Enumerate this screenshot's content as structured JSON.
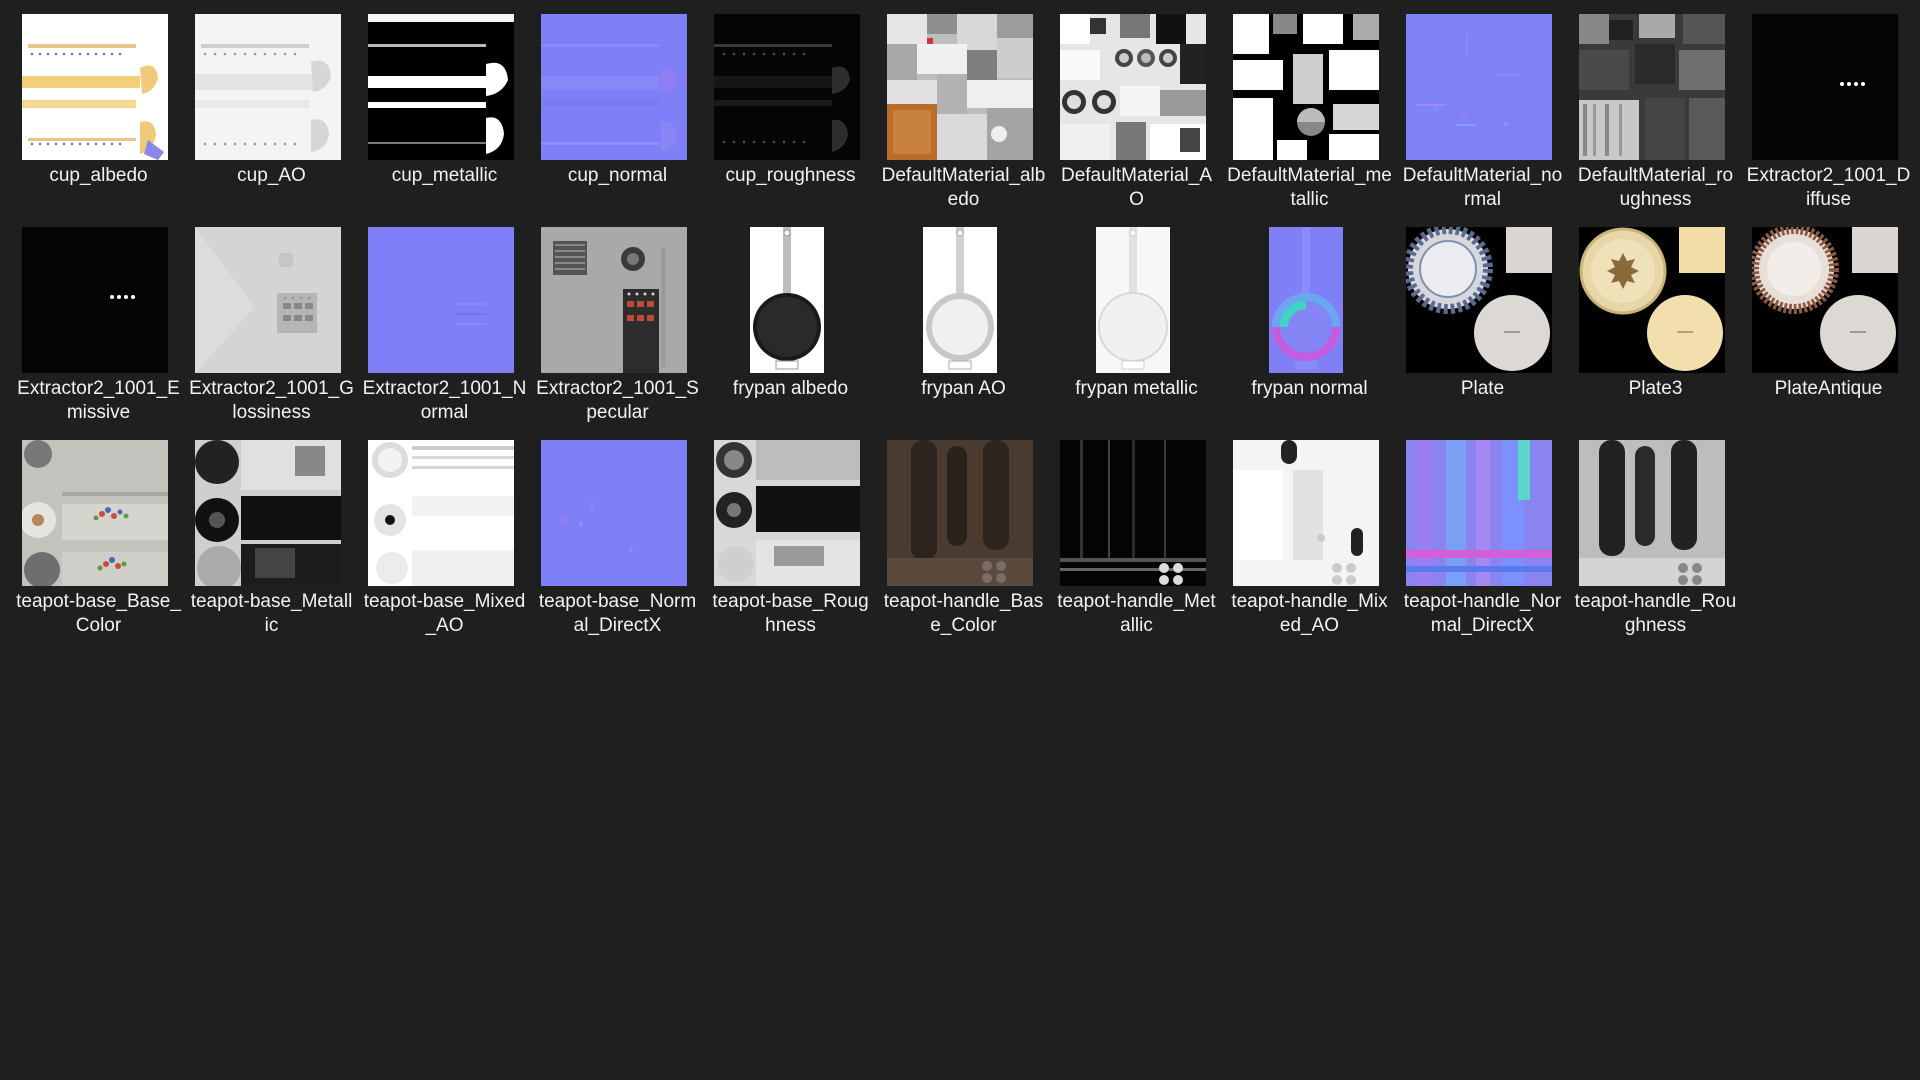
{
  "explorer": {
    "background": "#1f1f1f",
    "items": [
      {
        "name": "cup_albedo",
        "icon": "texture-cup-albedo-icon"
      },
      {
        "name": "cup_AO",
        "icon": "texture-cup-ao-icon"
      },
      {
        "name": "cup_metallic",
        "icon": "texture-cup-metallic-icon"
      },
      {
        "name": "cup_normal",
        "icon": "texture-cup-normal-icon"
      },
      {
        "name": "cup_roughness",
        "icon": "texture-cup-roughness-icon"
      },
      {
        "name": "DefaultMaterial_albedo",
        "icon": "texture-default-albedo-icon"
      },
      {
        "name": "DefaultMaterial_AO",
        "icon": "texture-default-ao-icon"
      },
      {
        "name": "DefaultMaterial_metallic",
        "icon": "texture-default-metallic-icon"
      },
      {
        "name": "DefaultMaterial_normal",
        "icon": "texture-default-normal-icon"
      },
      {
        "name": "DefaultMaterial_roughness",
        "icon": "texture-default-roughness-icon"
      },
      {
        "name": "Extractor2_1001_Diffuse",
        "icon": "texture-extractor-diffuse-icon"
      },
      {
        "name": "Extractor2_1001_Emissive",
        "icon": "texture-extractor-emissive-icon"
      },
      {
        "name": "Extractor2_1001_Glossiness",
        "icon": "texture-extractor-glossiness-icon"
      },
      {
        "name": "Extractor2_1001_Normal",
        "icon": "texture-extractor-normal-icon"
      },
      {
        "name": "Extractor2_1001_Specular",
        "icon": "texture-extractor-specular-icon"
      },
      {
        "name": "frypan albedo",
        "icon": "texture-frypan-albedo-icon"
      },
      {
        "name": "frypan AO",
        "icon": "texture-frypan-ao-icon"
      },
      {
        "name": "frypan metallic",
        "icon": "texture-frypan-metallic-icon"
      },
      {
        "name": "frypan normal",
        "icon": "texture-frypan-normal-icon"
      },
      {
        "name": "Plate",
        "icon": "texture-plate-icon"
      },
      {
        "name": "Plate3",
        "icon": "texture-plate3-icon"
      },
      {
        "name": "PlateAntique",
        "icon": "texture-plate-antique-icon"
      },
      {
        "name": "teapot-base_Base_Color",
        "icon": "texture-teapot-base-color-icon"
      },
      {
        "name": "teapot-base_Metallic",
        "icon": "texture-teapot-base-metallic-icon"
      },
      {
        "name": "teapot-base_Mixed_AO",
        "icon": "texture-teapot-base-ao-icon"
      },
      {
        "name": "teapot-base_Normal_DirectX",
        "icon": "texture-teapot-base-normal-icon"
      },
      {
        "name": "teapot-base_Roughness",
        "icon": "texture-teapot-base-roughness-icon"
      },
      {
        "name": "teapot-handle_Base_Color",
        "icon": "texture-teapot-handle-color-icon"
      },
      {
        "name": "teapot-handle_Metallic",
        "icon": "texture-teapot-handle-metallic-icon"
      },
      {
        "name": "teapot-handle_Mixed_AO",
        "icon": "texture-teapot-handle-ao-icon"
      },
      {
        "name": "teapot-handle_Normal_DirectX",
        "icon": "texture-teapot-handle-normal-icon"
      },
      {
        "name": "teapot-handle_Roughness",
        "icon": "texture-teapot-handle-roughness-icon"
      }
    ]
  }
}
